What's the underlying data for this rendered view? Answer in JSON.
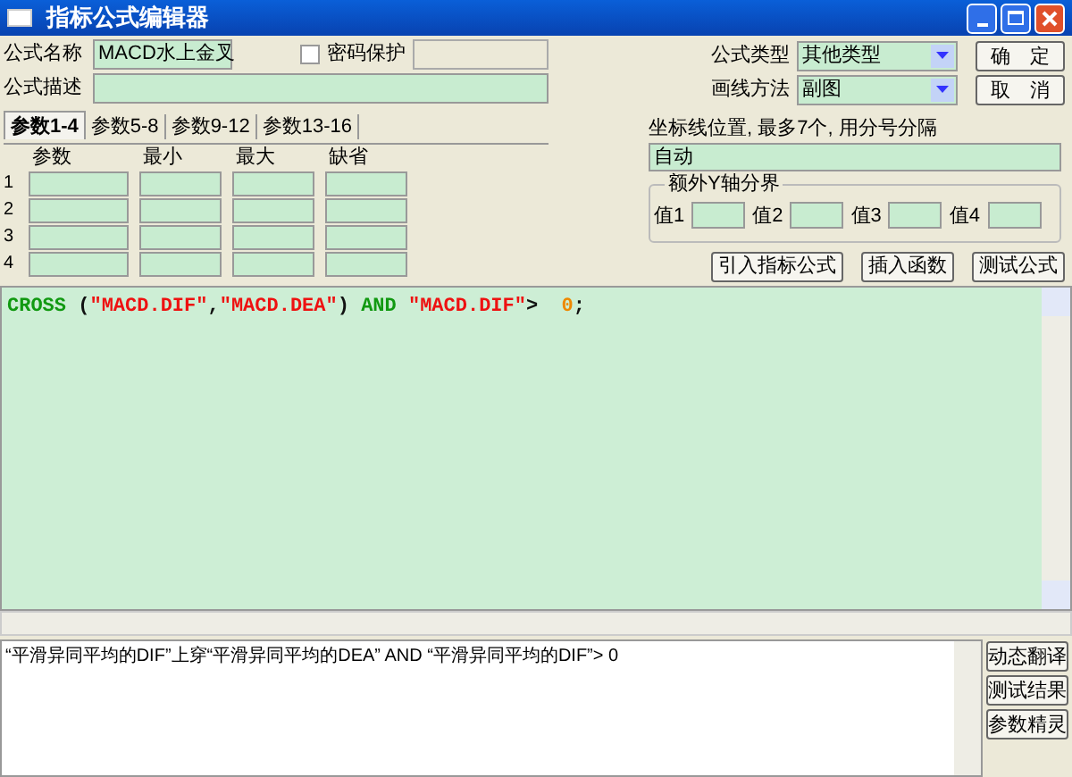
{
  "window": {
    "title": "指标公式编辑器"
  },
  "name_field": {
    "label": "公式名称",
    "value": "MACD水上金叉"
  },
  "password": {
    "label": "密码保护",
    "checked": false
  },
  "description_field": {
    "label": "公式描述"
  },
  "formula_type": {
    "label": "公式类型",
    "value": "其他类型"
  },
  "draw_method": {
    "label": "画线方法",
    "value": "副图"
  },
  "buttons_top": [
    "确　定",
    "取　消"
  ],
  "tabs": [
    {
      "label": "参数1-4",
      "selected": true
    },
    {
      "label": "参数5-8",
      "selected": false
    },
    {
      "label": "参数9-12",
      "selected": false
    },
    {
      "label": "参数13-16",
      "selected": false
    }
  ],
  "param_columns": [
    "参数",
    "最小",
    "最大",
    "缺省"
  ],
  "param_rows": [
    "1",
    "2",
    "3",
    "4"
  ],
  "axis_lines": {
    "label": "坐标线位置, 最多7个, 用分号分隔",
    "value": "自动"
  },
  "extra_y": {
    "title": "额外Y轴分界",
    "values": [
      "值1",
      "值2",
      "值3",
      "值4"
    ]
  },
  "action_buttons": [
    "引入指标公式",
    "插入函数",
    "测试公式"
  ],
  "code": [
    {
      "kind": "keyword",
      "text": "CROSS "
    },
    {
      "kind": "punct",
      "text": "("
    },
    {
      "kind": "string",
      "text": "\"MACD.DIF\""
    },
    {
      "kind": "punct",
      "text": ","
    },
    {
      "kind": "string",
      "text": "\"MACD.DEA\""
    },
    {
      "kind": "punct",
      "text": ") "
    },
    {
      "kind": "keyword",
      "text": "AND "
    },
    {
      "kind": "string",
      "text": "\"MACD.DIF\""
    },
    {
      "kind": "punct",
      "text": ">  "
    },
    {
      "kind": "number",
      "text": "0"
    },
    {
      "kind": "punct",
      "text": ";"
    }
  ],
  "translation": "“平滑异同平均的DIF”上穿“平滑异同平均的DEA” AND “平滑异同平均的DIF”>  0",
  "side_buttons": [
    "动态翻译",
    "测试结果",
    "参数精灵"
  ]
}
